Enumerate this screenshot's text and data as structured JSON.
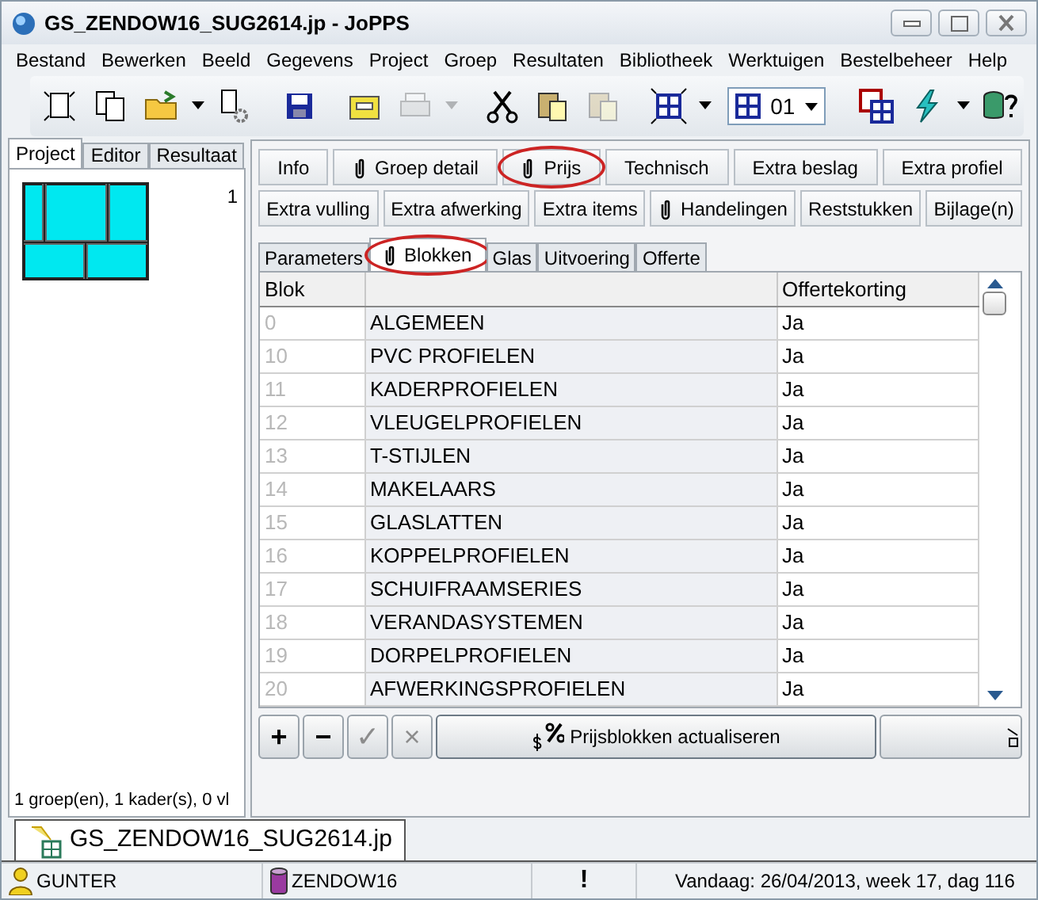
{
  "window": {
    "title": "GS_ZENDOW16_SUG2614.jp - JoPPS"
  },
  "menu": [
    "Bestand",
    "Bewerken",
    "Beeld",
    "Gegevens",
    "Project",
    "Groep",
    "Resultaten",
    "Bibliotheek",
    "Werktuigen",
    "Bestelbeheer",
    "Help"
  ],
  "toolbar": {
    "items": [
      {
        "kind": "new",
        "disabled": false,
        "dropdown": false
      },
      {
        "kind": "copy",
        "disabled": false,
        "dropdown": false
      },
      {
        "kind": "open",
        "disabled": false,
        "dropdown": true
      },
      {
        "kind": "import",
        "disabled": false,
        "dropdown": false
      },
      {
        "kind": "save",
        "disabled": false,
        "dropdown": false
      },
      {
        "kind": "tray",
        "disabled": false,
        "dropdown": false
      },
      {
        "kind": "print",
        "disabled": true,
        "dropdown": true
      },
      {
        "kind": "cut",
        "disabled": false,
        "dropdown": false
      },
      {
        "kind": "paste",
        "disabled": false,
        "dropdown": false
      },
      {
        "kind": "paste",
        "disabled": true,
        "dropdown": false
      },
      {
        "kind": "grid",
        "disabled": false,
        "dropdown": true
      },
      {
        "kind": "combo",
        "value": "01"
      },
      {
        "kind": "windows",
        "disabled": false,
        "dropdown": false
      },
      {
        "kind": "lightning",
        "disabled": false,
        "dropdown": true
      },
      {
        "kind": "dbhelp",
        "disabled": false,
        "dropdown": false
      }
    ]
  },
  "left_panel": {
    "tabs": [
      {
        "label": "Project",
        "selected": true
      },
      {
        "label": "Editor",
        "selected": false
      },
      {
        "label": "Resultaat",
        "selected": false
      }
    ],
    "thumbnail_number": "1",
    "summary": "1 groep(en), 1 kader(s), 0 vl"
  },
  "detail_buttons": [
    [
      {
        "label": "Info",
        "attachment": false,
        "highlighted": false
      },
      {
        "label": "Groep detail",
        "attachment": true,
        "highlighted": false
      },
      {
        "label": "Prijs",
        "attachment": true,
        "highlighted": true
      },
      {
        "label": "Technisch",
        "attachment": false,
        "highlighted": false
      },
      {
        "label": "Extra beslag",
        "attachment": false,
        "highlighted": false
      },
      {
        "label": "Extra profiel",
        "attachment": false,
        "highlighted": false
      }
    ],
    [
      {
        "label": "Extra vulling",
        "attachment": false,
        "highlighted": false
      },
      {
        "label": "Extra afwerking",
        "attachment": false,
        "highlighted": false
      },
      {
        "label": "Extra items",
        "attachment": false,
        "highlighted": false
      },
      {
        "label": "Handelingen",
        "attachment": true,
        "highlighted": false
      },
      {
        "label": "Reststukken",
        "attachment": false,
        "highlighted": false
      },
      {
        "label": "Bijlage(n)",
        "attachment": false,
        "highlighted": false
      }
    ]
  ],
  "sub_tabs": [
    {
      "label": "Parameters",
      "selected": false,
      "attachment": false,
      "highlighted": false
    },
    {
      "label": "Blokken",
      "selected": true,
      "attachment": true,
      "highlighted": true
    },
    {
      "label": "Glas",
      "selected": false,
      "attachment": false,
      "highlighted": false
    },
    {
      "label": "Uitvoering",
      "selected": false,
      "attachment": false,
      "highlighted": false
    },
    {
      "label": "Offerte",
      "selected": false,
      "attachment": false,
      "highlighted": false
    }
  ],
  "table": {
    "column_headings": [
      "Blok",
      "Offertekorting"
    ],
    "rows": [
      {
        "blok": "0",
        "name": "ALGEMEEN",
        "korting": "Ja"
      },
      {
        "blok": "10",
        "name": "PVC PROFIELEN",
        "korting": "Ja"
      },
      {
        "blok": "11",
        "name": "KADERPROFIELEN",
        "korting": "Ja"
      },
      {
        "blok": "12",
        "name": "VLEUGELPROFIELEN",
        "korting": "Ja"
      },
      {
        "blok": "13",
        "name": "T-STIJLEN",
        "korting": "Ja"
      },
      {
        "blok": "14",
        "name": "MAKELAARS",
        "korting": "Ja"
      },
      {
        "blok": "15",
        "name": "GLASLATTEN",
        "korting": "Ja"
      },
      {
        "blok": "16",
        "name": "KOPPELPROFIELEN",
        "korting": "Ja"
      },
      {
        "blok": "17",
        "name": "SCHUIFRAAMSERIES",
        "korting": "Ja"
      },
      {
        "blok": "18",
        "name": "VERANDASYSTEMEN",
        "korting": "Ja"
      },
      {
        "blok": "19",
        "name": "DORPELPROFIELEN",
        "korting": "Ja"
      },
      {
        "blok": "20",
        "name": "AFWERKINGSPROFIELEN",
        "korting": "Ja"
      }
    ]
  },
  "bottom_bar": {
    "buttons": [
      {
        "label": "+",
        "disabled": false
      },
      {
        "label": "−",
        "disabled": false
      },
      {
        "label": "✓",
        "disabled": true
      },
      {
        "label": "×",
        "disabled": true
      }
    ],
    "action": "Prijsblokken actualiseren"
  },
  "document_tab": {
    "label": "GS_ZENDOW16_SUG2614.jp"
  },
  "status_bar": {
    "user": "GUNTER",
    "database": "ZENDOW16",
    "alert": "!",
    "date": "Vandaag: 26/04/2013, week 17, dag 116"
  }
}
